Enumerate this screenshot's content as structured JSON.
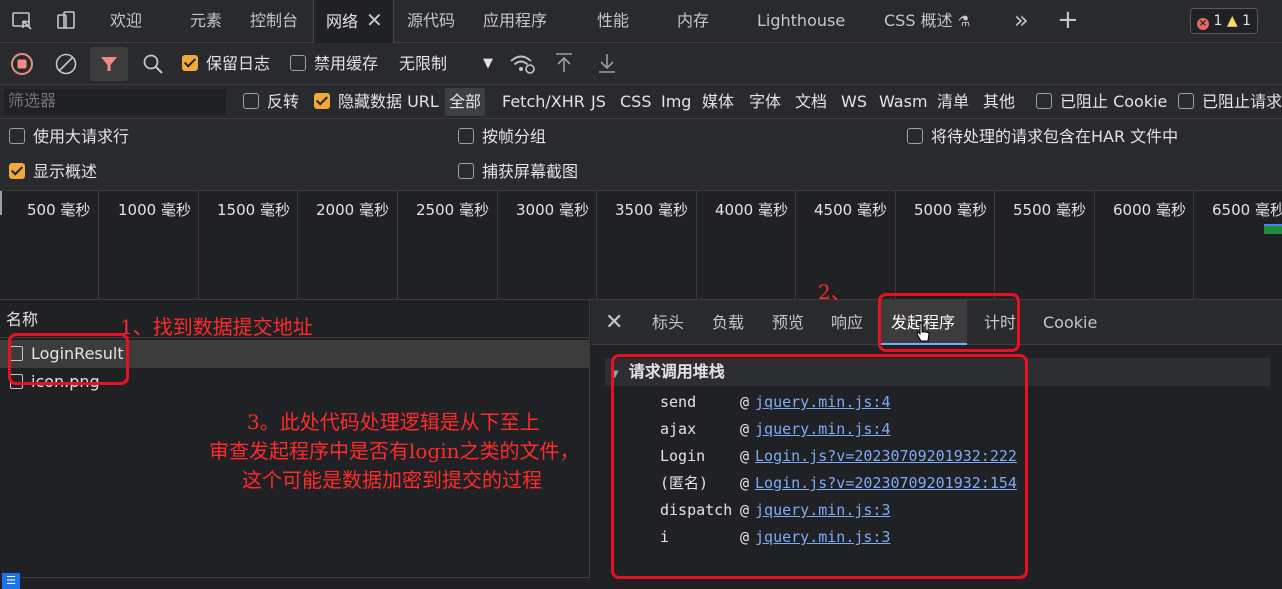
{
  "tabbar": {
    "tabs": [
      {
        "label": "欢迎"
      },
      {
        "label": "元素"
      },
      {
        "label": "控制台"
      },
      {
        "label": "网络"
      },
      {
        "label": "源代码"
      },
      {
        "label": "应用程序"
      },
      {
        "label": "性能"
      },
      {
        "label": "内存"
      },
      {
        "label": "Lighthouse"
      },
      {
        "label": "CSS 概述"
      }
    ],
    "active_close": "✕",
    "more": "»",
    "add": "+",
    "errors": "1",
    "warnings": "1"
  },
  "toolbar": {
    "preserve_log": "保留日志",
    "disable_cache": "禁用缓存",
    "throttle": "无限制"
  },
  "filter": {
    "placeholder": "筛选器",
    "invert": "反转",
    "hide_data_urls": "隐藏数据 URL",
    "types": [
      "全部",
      "Fetch/XHR",
      "JS",
      "CSS",
      "Img",
      "媒体",
      "字体",
      "文档",
      "WS",
      "Wasm",
      "清单",
      "其他"
    ],
    "blocked_cookies": "已阻止 Cookie",
    "blocked_requests": "已阻止请求"
  },
  "options": {
    "large_rows": "使用大请求行",
    "group_by_frame": "按帧分组",
    "include_pending_har": "将待处理的请求包含在HAR 文件中",
    "show_overview": "显示概述",
    "capture_screenshots": "捕获屏幕截图"
  },
  "timeline": {
    "ticks": [
      "500 毫秒",
      "1000 毫秒",
      "1500 毫秒",
      "2000 毫秒",
      "2500 毫秒",
      "3000 毫秒",
      "3500 毫秒",
      "4000 毫秒",
      "4500 毫秒",
      "5000 毫秒",
      "5500 毫秒",
      "6000 毫秒",
      "6500 毫秒"
    ]
  },
  "requests": {
    "header": "名称",
    "rows": [
      {
        "name": "LoginResult"
      },
      {
        "name": "icon.png"
      }
    ]
  },
  "detail": {
    "close": "✕",
    "tabs": [
      "标头",
      "负载",
      "预览",
      "响应",
      "发起程序",
      "计时",
      "Cookie"
    ],
    "section_title": "请求调用堆栈",
    "stack": [
      {
        "fn": "send",
        "at": "@",
        "link": "jquery.min.js:4"
      },
      {
        "fn": "ajax",
        "at": "@",
        "link": "jquery.min.js:4"
      },
      {
        "fn": "Login",
        "at": "@",
        "link": "Login.js?v=20230709201932:222"
      },
      {
        "fn": "(匿名)",
        "at": "@",
        "link": "Login.js?v=20230709201932:154"
      },
      {
        "fn": "dispatch",
        "at": "@",
        "link": "jquery.min.js:3"
      },
      {
        "fn": "i",
        "at": "@",
        "link": "jquery.min.js:3"
      }
    ]
  },
  "annotations": {
    "step1": "1、找到数据提交地址",
    "step2": "2、",
    "step3_line1": "3。此处代码处理逻辑是从下至上",
    "step3_line2": "审查发起程序中是否有login之类的文件，",
    "step3_line3": "这个可能是数据加密到提交的过程"
  },
  "colors": {
    "accent_blue": "#7cacf8",
    "annotation_red": "#ff2a2a",
    "checkbox_orange": "#f0a93a"
  }
}
